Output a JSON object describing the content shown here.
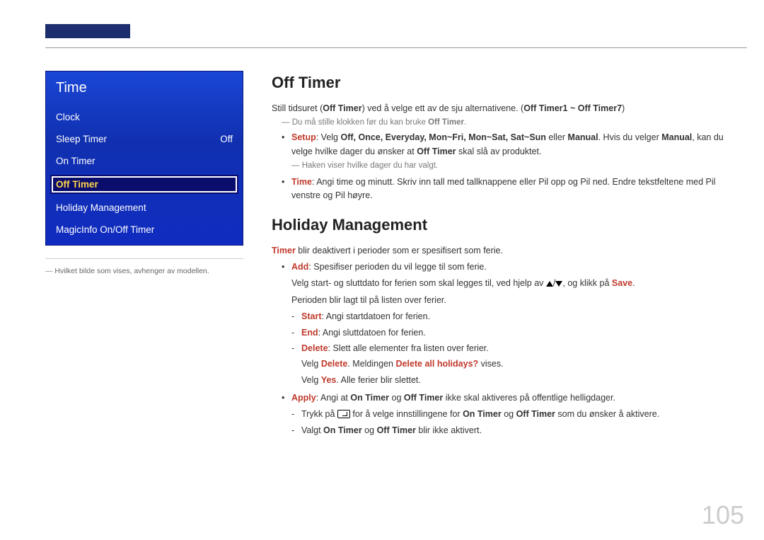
{
  "page_number": "105",
  "menu": {
    "title": "Time",
    "items": [
      {
        "label": "Clock",
        "value": ""
      },
      {
        "label": "Sleep Timer",
        "value": "Off"
      },
      {
        "label": "On Timer",
        "value": ""
      },
      {
        "label": "Off Timer",
        "value": ""
      },
      {
        "label": "Holiday Management",
        "value": ""
      },
      {
        "label": "MagicInfo On/Off Timer",
        "value": ""
      }
    ],
    "footnote": "Hvilket bilde som vises, avhenger av modellen."
  },
  "sections": {
    "off_timer": {
      "heading": "Off Timer",
      "intro_pre": "Still tidsuret (",
      "intro_bold1": "Off Timer",
      "intro_mid": ") ved å velge ett av de sju alternativene. (",
      "intro_bold2": "Off Timer1 ~ Off Timer7",
      "intro_post": ")",
      "note_pre": "Du må stille klokken før du kan bruke ",
      "note_bold": "Off Timer",
      "note_post": ".",
      "setup": {
        "label": "Setup",
        "pre": ": Velg ",
        "opts": "Off, Once, Everyday, Mon~Fri, Mon~Sat, Sat~Sun",
        "mid1": " eller ",
        "manual": "Manual",
        "mid2": ". Hvis du velger ",
        "post": ", kan du velge hvilke dager du ønsker at ",
        "off_timer": "Off Timer",
        "tail": " skal slå av produktet.",
        "subnote": "Haken viser hvilke dager du har valgt."
      },
      "time": {
        "label": "Time",
        "text": ": Angi time og minutt. Skriv inn tall med tallknappene eller Pil opp og Pil ned. Endre tekstfeltene med Pil venstre og Pil høyre."
      }
    },
    "holiday": {
      "heading": "Holiday Management",
      "intro_kw": "Timer",
      "intro_rest": " blir deaktivert i perioder som er spesifisert som ferie.",
      "add": {
        "label": "Add",
        "rest": ": Spesifiser perioden du vil legge til som ferie.",
        "line2_pre": "Velg start- og sluttdato for ferien som skal legges til, ved hjelp av ",
        "line2_mid": "/",
        "line2_post": ", og klikk på ",
        "save": "Save",
        "line2_tail": ".",
        "line3": "Perioden blir lagt til på listen over ferier.",
        "start_label": "Start",
        "start_rest": ": Angi startdatoen for ferien.",
        "end_label": "End",
        "end_rest": ": Angi sluttdatoen for ferien.",
        "delete_label": "Delete",
        "delete_rest": ": Slett alle elementer fra listen over ferier.",
        "delete_l2_pre": "Velg ",
        "delete_l2_kw1": "Delete",
        "delete_l2_mid": ". Meldingen ",
        "delete_l2_kw2": "Delete all holidays?",
        "delete_l2_post": " vises.",
        "delete_l3_pre": "Velg ",
        "delete_l3_kw": "Yes",
        "delete_l3_post": ". Alle ferier blir slettet."
      },
      "apply": {
        "label": "Apply",
        "pre": ": Angi at ",
        "on_timer": "On Timer",
        "mid1": " og ",
        "off_timer": "Off Timer",
        "rest": " ikke skal aktiveres på offentlige helligdager.",
        "d1_pre": "Trykk på ",
        "d1_mid": " for å velge innstillingene for ",
        "d1_post": " som du ønsker å aktivere.",
        "d2_pre": "Valgt ",
        "d2_post": " blir ikke aktivert."
      }
    }
  }
}
